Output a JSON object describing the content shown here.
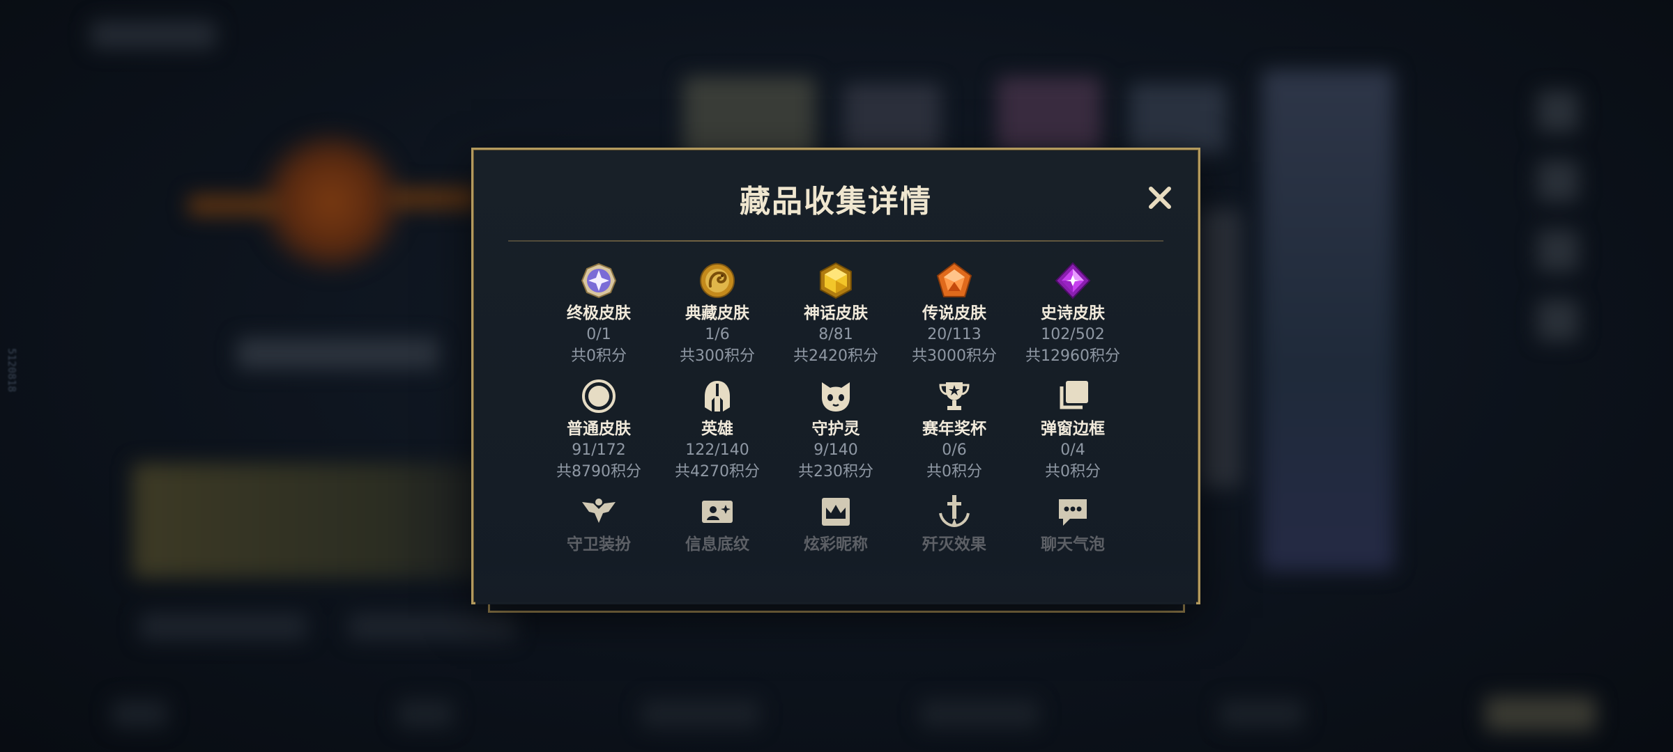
{
  "side_id": "5120818",
  "modal": {
    "title": "藏品收集详情",
    "close_icon": "close-icon",
    "rows": [
      [
        {
          "icon": "ultimate-skin-icon",
          "name": "终极皮肤",
          "count": "0/1",
          "points": "共0积分"
        },
        {
          "icon": "classic-dragon-skin-icon",
          "name": "典藏皮肤",
          "count": "1/6",
          "points": "共300积分"
        },
        {
          "icon": "mythic-skin-icon",
          "name": "神话皮肤",
          "count": "8/81",
          "points": "共2420积分"
        },
        {
          "icon": "legendary-skin-icon",
          "name": "传说皮肤",
          "count": "20/113",
          "points": "共3000积分"
        },
        {
          "icon": "epic-skin-icon",
          "name": "史诗皮肤",
          "count": "102/502",
          "points": "共12960积分"
        }
      ],
      [
        {
          "icon": "normal-skin-icon",
          "name": "普通皮肤",
          "count": "91/172",
          "points": "共8790积分"
        },
        {
          "icon": "helmet-icon",
          "name": "英雄",
          "count": "122/140",
          "points": "共4270积分"
        },
        {
          "icon": "spirit-icon",
          "name": "守护灵",
          "count": "9/140",
          "points": "共230积分"
        },
        {
          "icon": "trophy-icon",
          "name": "赛年奖杯",
          "count": "0/6",
          "points": "共0积分"
        },
        {
          "icon": "frame-stack-icon",
          "name": "弹窗边框",
          "count": "0/4",
          "points": "共0积分"
        }
      ],
      [
        {
          "icon": "ward-skin-icon",
          "name": "守卫装扮"
        },
        {
          "icon": "banner-card-icon",
          "name": "信息底纹"
        },
        {
          "icon": "crown-name-icon",
          "name": "炫彩昵称"
        },
        {
          "icon": "sword-finisher-icon",
          "name": "歼灭效果"
        },
        {
          "icon": "chat-bubble-icon",
          "name": "聊天气泡"
        }
      ]
    ]
  },
  "colors": {
    "accent_gold": "#b39a5e",
    "title_text": "#efe6cf",
    "muted_text": "#8f98a4",
    "modal_bg": "#182028"
  }
}
